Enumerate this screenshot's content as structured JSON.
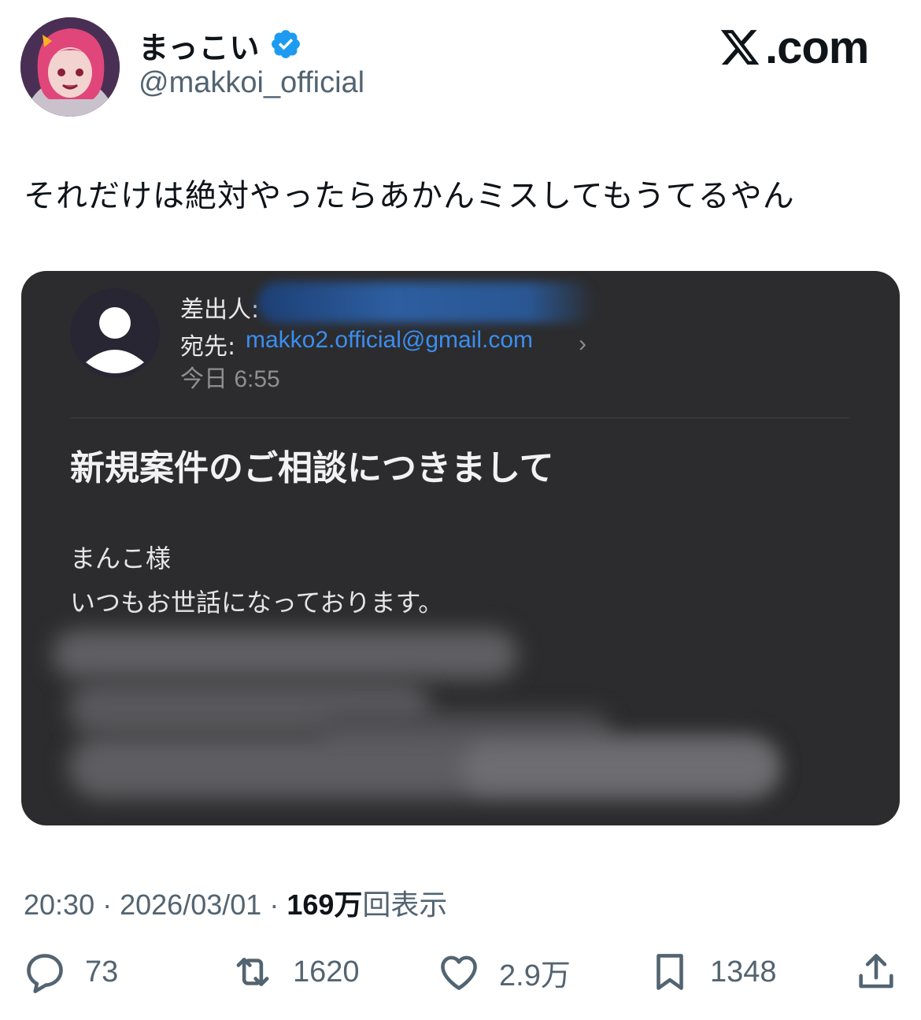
{
  "author": {
    "display_name": "まっこい",
    "handle": "@makkoi_official",
    "verified": true
  },
  "brand": {
    "logo_text": "com",
    "logo_suffix": ".com"
  },
  "tweet": {
    "text": "それだけは絶対やったらあかんミスしてもうてるやん"
  },
  "media": {
    "from_label": "差出人:",
    "to_label": "宛先:",
    "to_email": "makko2.official@gmail.com",
    "date": "今日 6:55",
    "subject": "新規案件のご相談につきまして",
    "body_lines": [
      "まんこ様",
      "いつもお世話になっております。"
    ]
  },
  "meta": {
    "time": "20:30",
    "date": "2026/03/01",
    "views_number": "169",
    "views_unit": "万",
    "views_suffix": "回表示"
  },
  "actions": {
    "replies": "73",
    "reposts": "1620",
    "likes": "2.9万",
    "bookmarks": "1348"
  },
  "colors": {
    "verified_blue": "#1d9bf0",
    "link_blue": "#3b8ef0",
    "secondary_text": "#536471",
    "media_bg": "#2c2c2e"
  }
}
